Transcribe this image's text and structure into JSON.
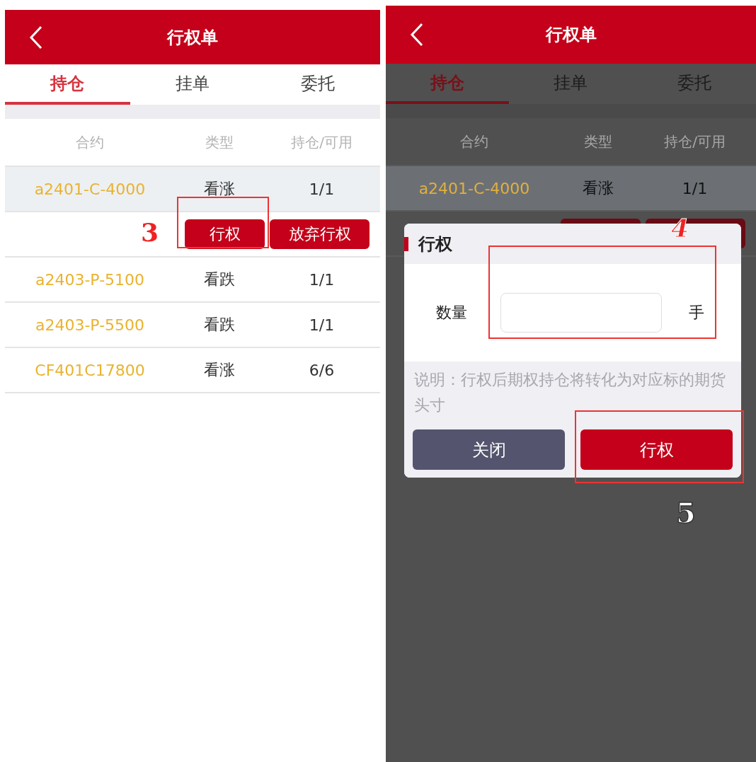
{
  "panels": [
    {
      "header": {
        "title": "行权单"
      },
      "tabs": [
        {
          "label": "持仓",
          "selected": true
        },
        {
          "label": "挂单",
          "selected": false
        },
        {
          "label": "委托",
          "selected": false
        }
      ],
      "columns": [
        "合约",
        "类型",
        "持仓/可用"
      ],
      "rows": [
        {
          "kind": "position",
          "contract": "a2401-C-4000",
          "type": "看涨",
          "quantity": "1/1",
          "selected": true
        },
        {
          "kind": "actions",
          "buttons": [
            "行权",
            "放弃行权"
          ]
        },
        {
          "kind": "position",
          "contract": "a2403-P-5100",
          "type": "看跌",
          "quantity": "1/1",
          "selected": false
        },
        {
          "kind": "position",
          "contract": "a2403-P-5500",
          "type": "看跌",
          "quantity": "1/1",
          "selected": false
        },
        {
          "kind": "position",
          "contract": "CF401C17800",
          "type": "看涨",
          "quantity": "6/6",
          "selected": false
        }
      ],
      "annotations": [
        {
          "label": "3",
          "kind": "plain"
        }
      ]
    },
    {
      "header": {
        "title": "行权单"
      },
      "tabs": [
        {
          "label": "持仓",
          "selected": true
        },
        {
          "label": "挂单",
          "selected": false
        },
        {
          "label": "委托",
          "selected": false
        }
      ],
      "columns": [
        "合约",
        "类型",
        "持仓/可用"
      ],
      "rows": [
        {
          "kind": "position",
          "contract": "a2401-C-4000",
          "type": "看涨",
          "quantity": "1/1",
          "selected": true
        },
        {
          "kind": "covered"
        }
      ],
      "dialog": {
        "title": "行权",
        "field_label": "数量",
        "unit": "手",
        "note": "说明：行权后期权持仓将转化为对应标的期货头寸",
        "buttons": [
          {
            "label": "关闭",
            "kind": "secondary"
          },
          {
            "label": "行权",
            "kind": "primary"
          }
        ]
      },
      "annotations": [
        {
          "label": "4",
          "kind": "outlined"
        },
        {
          "label": "5",
          "kind": "inverse"
        }
      ]
    }
  ]
}
